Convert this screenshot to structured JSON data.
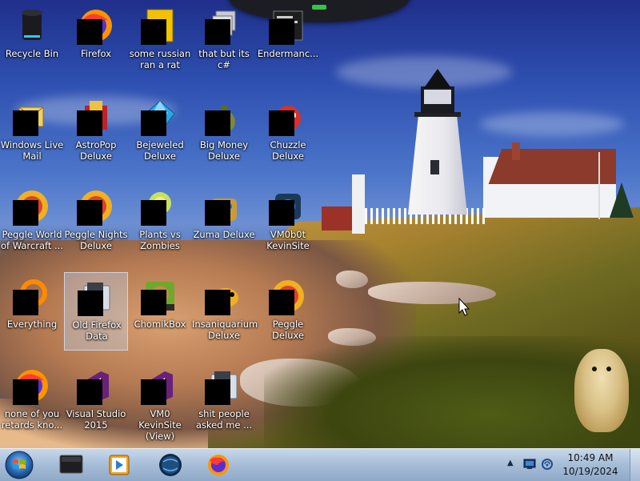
{
  "desktop": {
    "icons": [
      {
        "label": "Recycle Bin",
        "icon": "recycle-bin-icon"
      },
      {
        "label": "Windows Live\nMail",
        "icon": "mail-icon"
      },
      {
        "label": "Peggle World\nof Warcraft ...",
        "icon": "peggle-icon"
      },
      {
        "label": "Everything",
        "icon": "search-ring-icon"
      },
      {
        "label": "none of you\nretards kno...",
        "icon": "firefox-icon"
      },
      {
        "label": "Firefox",
        "icon": "firefox-icon"
      },
      {
        "label": "AstroPop\nDeluxe",
        "icon": "astropop-icon"
      },
      {
        "label": "Peggle Nights\nDeluxe",
        "icon": "peggle-icon"
      },
      {
        "label": "Old Firefox\nData",
        "icon": "folder-icon"
      },
      {
        "label": "Visual Studio\n2015",
        "icon": "visual-studio-icon"
      },
      {
        "label": "some russian\nran a rat",
        "icon": "document-icon"
      },
      {
        "label": "Bejeweled\nDeluxe",
        "icon": "gem-icon"
      },
      {
        "label": "Plants vs\nZombies",
        "icon": "plant-icon"
      },
      {
        "label": "ChomikBox",
        "icon": "hamster-box-icon"
      },
      {
        "label": "VM0 KevinSite\n(View)",
        "icon": "visual-studio-icon"
      },
      {
        "label": "that but its c#",
        "icon": "windows-stack-icon"
      },
      {
        "label": "Big Money\nDeluxe",
        "icon": "money-bag-icon"
      },
      {
        "label": "Zuma Deluxe",
        "icon": "frog-idol-icon"
      },
      {
        "label": "Insaniquarium\nDeluxe",
        "icon": "fish-icon"
      },
      {
        "label": "shit people\nasked me ...",
        "icon": "folder-icon"
      },
      {
        "label": "Endermanc...",
        "icon": "terminal-icon"
      },
      {
        "label": "Chuzzle\nDeluxe",
        "icon": "chuzzle-icon"
      },
      {
        "label": "VM0b0t\nKevinSite",
        "icon": "app-icon"
      },
      {
        "label": "Peggle Deluxe",
        "icon": "peggle-icon"
      }
    ]
  },
  "taskbar": {
    "start": {
      "icon": "windows-start-orb-icon"
    },
    "pinned": [
      {
        "icon": "app-box-icon"
      },
      {
        "icon": "media-player-icon"
      },
      {
        "icon": "globe-icon"
      },
      {
        "icon": "firefox-icon"
      }
    ],
    "tray": {
      "overflow_icon": "chevron-up-icon",
      "icons": [
        "action-center-icon",
        "network-icon"
      ],
      "time": "10:49 AM",
      "date": "10/19/2024"
    }
  }
}
